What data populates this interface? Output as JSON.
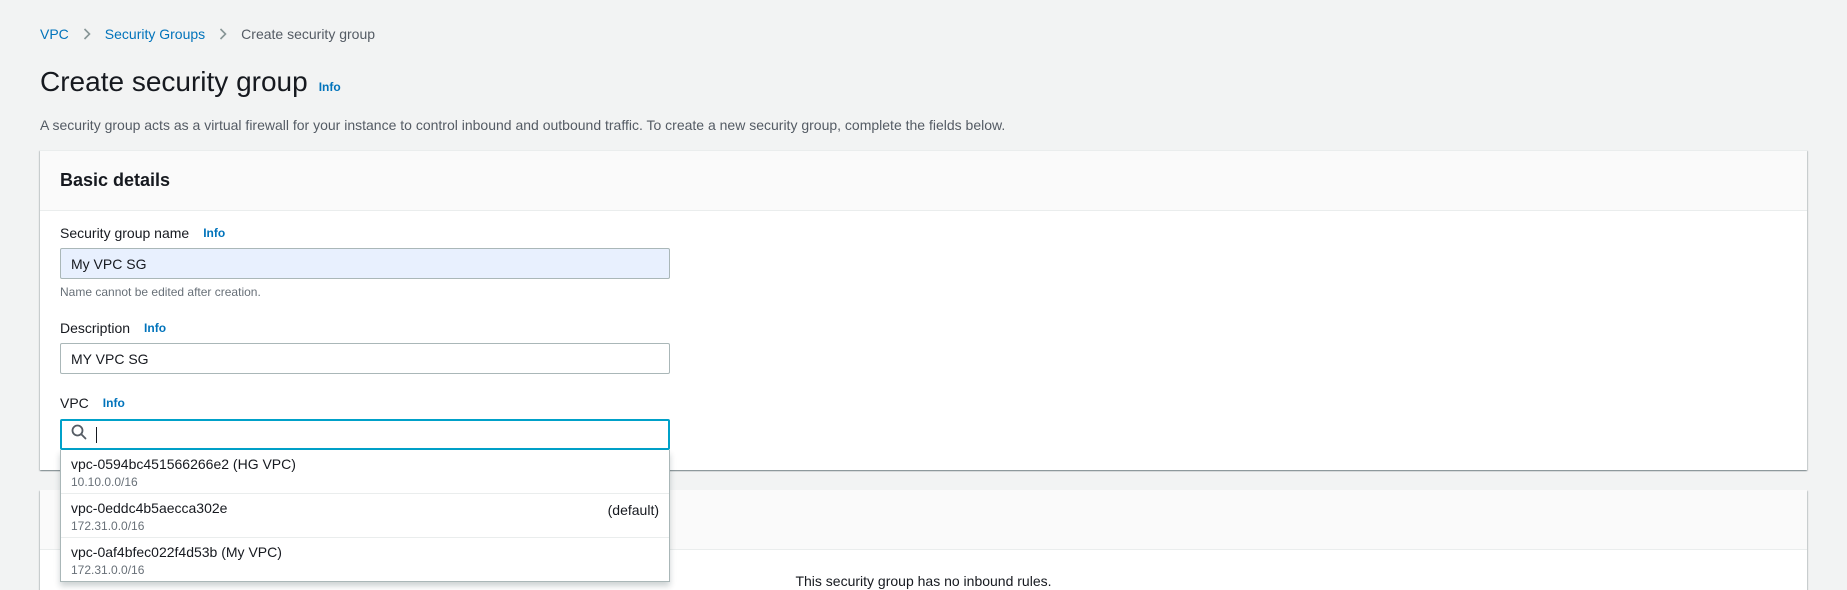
{
  "breadcrumb": {
    "items": [
      "VPC",
      "Security Groups"
    ],
    "current": "Create security group"
  },
  "header": {
    "title": "Create security group",
    "info": "Info",
    "description": "A security group acts as a virtual firewall for your instance to control inbound and outbound traffic. To create a new security group, complete the fields below."
  },
  "basic_details": {
    "title": "Basic details",
    "name_field": {
      "label": "Security group name",
      "info": "Info",
      "value": "My VPC SG",
      "hint": "Name cannot be edited after creation."
    },
    "description_field": {
      "label": "Description",
      "info": "Info",
      "value": "MY VPC SG"
    },
    "vpc_field": {
      "label": "VPC",
      "info": "Info",
      "value": ""
    }
  },
  "vpc_options": [
    {
      "id": "vpc-0594bc451566266e2 (HG VPC)",
      "cidr": "10.10.0.0/16",
      "tag": ""
    },
    {
      "id": "vpc-0eddc4b5aecca302e",
      "cidr": "172.31.0.0/16",
      "tag": "(default)"
    },
    {
      "id": "vpc-0af4bfec022f4d53b (My VPC)",
      "cidr": "172.31.0.0/16",
      "tag": ""
    }
  ],
  "inbound_rules": {
    "empty_text": "This security group has no inbound rules."
  },
  "colors": {
    "link": "#0073bb",
    "focus": "#00a1c9",
    "background": "#f2f3f3"
  }
}
